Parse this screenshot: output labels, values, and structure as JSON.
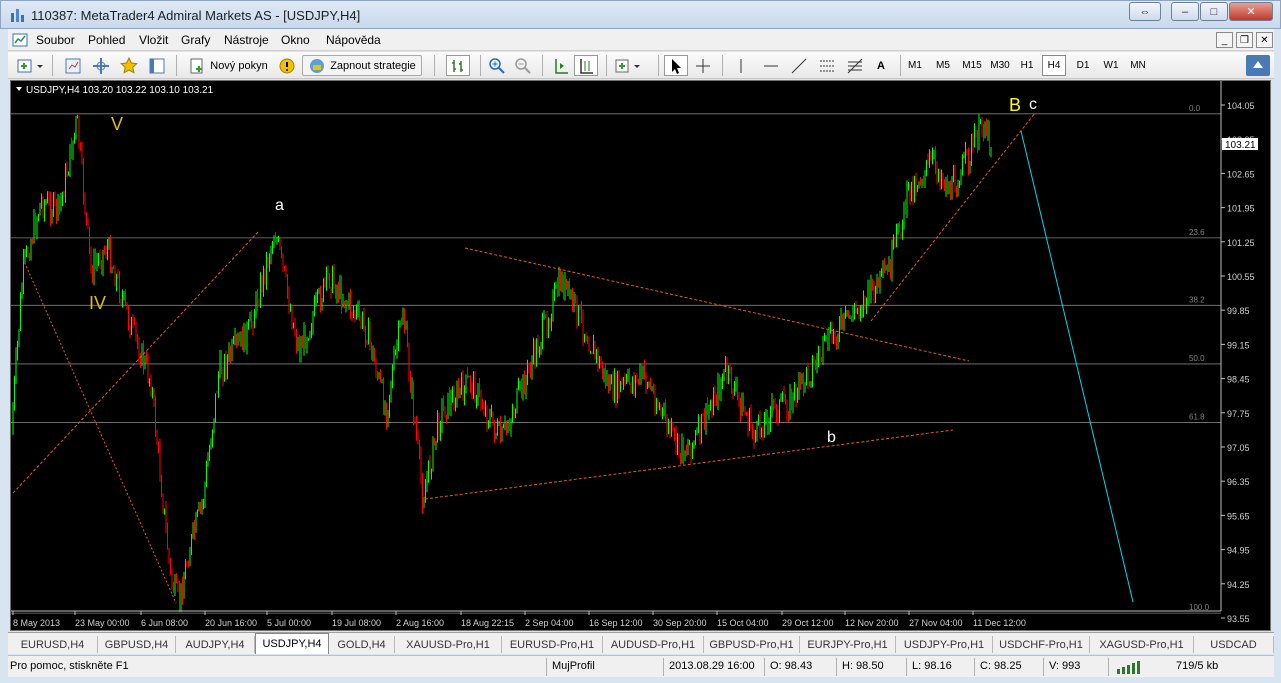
{
  "window": {
    "title": "110387: MetaTrader4 Admiral Markets AS - [USDJPY,H4]",
    "controls": {
      "restore": "⇔",
      "minimize": "–",
      "maximize": "□",
      "close": "✕"
    }
  },
  "menu": {
    "items": [
      "Soubor",
      "Pohled",
      "Vložit",
      "Grafy",
      "Nástroje",
      "Okno",
      "Nápověda"
    ],
    "mdi_controls": [
      "_",
      "❐",
      "✕"
    ]
  },
  "toolbar": {
    "new_order_label": "Nový pokyn",
    "expert_label": "Zapnout strategie",
    "drawing_tools": [
      "A"
    ],
    "timeframes": [
      "M1",
      "M5",
      "M15",
      "M30",
      "H1",
      "H4",
      "D1",
      "W1",
      "MN"
    ],
    "active_timeframe": "H4"
  },
  "chart": {
    "header": "USDJPY,H4  103.20 103.22 103.10 103.21",
    "current_price": "103.21",
    "background": "#000000",
    "bull_color": "#00ff00",
    "bear_color": "#ff0000",
    "price_axis": [
      "104.05",
      "103.35",
      "102.65",
      "101.95",
      "101.25",
      "100.55",
      "99.85",
      "99.15",
      "98.45",
      "97.75",
      "97.05",
      "96.35",
      "95.65",
      "94.95",
      "94.25",
      "93.55"
    ],
    "time_axis": [
      "8 May 2013",
      "23 May 00:00",
      "6 Jun 08:00",
      "20 Jun 16:00",
      "5 Jul 00:00",
      "19 Jul 08:00",
      "2 Aug 16:00",
      "18 Aug 22:15",
      "2 Sep 04:00",
      "16 Sep 12:00",
      "30 Sep 20:00",
      "15 Oct 04:00",
      "29 Oct 12:00",
      "12 Nov 20:00",
      "27 Nov 04:00",
      "11 Dec 12:00"
    ],
    "fib_levels": [
      {
        "label": "0.0",
        "price": 103.87
      },
      {
        "label": "23.6",
        "price": 101.33
      },
      {
        "label": "38.2",
        "price": 99.95
      },
      {
        "label": "50.0",
        "price": 98.75
      },
      {
        "label": "61.8",
        "price": 97.55
      },
      {
        "label": "100.0",
        "price": 93.65
      }
    ],
    "wave_labels": [
      {
        "text": "V",
        "color": "#e0c000"
      },
      {
        "text": "IV",
        "color": "#e0c000"
      },
      {
        "text": "a",
        "color": "#ffffff"
      },
      {
        "text": "b",
        "color": "#ffffff"
      },
      {
        "text": "B",
        "color": "#ffff00"
      },
      {
        "text": "c",
        "color": "#ffffff"
      }
    ],
    "line_colors": {
      "trend": "#e05a2a",
      "projection": "#00d8e8",
      "fib": "#808080"
    }
  },
  "tabs": {
    "items": [
      "EURUSD,H4",
      "GBPUSD,H4",
      "AUDJPY,H4",
      "USDJPY,H4",
      "GOLD,H4",
      "XAUUSD-Pro,H1",
      "EURUSD-Pro,H1",
      "AUDUSD-Pro,H1",
      "GBPUSD-Pro,H1",
      "EURJPY-Pro,H1",
      "USDJPY-Pro,H1",
      "USDCHF-Pro,H1",
      "XAGUSD-Pro,H1",
      "USDCAD"
    ],
    "active": "USDJPY,H4"
  },
  "status": {
    "help": "Pro pomoc, stiskněte F1",
    "profile": "MujProfil",
    "datetime": "2013.08.29 16:00",
    "open": "O: 98.43",
    "high": "H: 98.50",
    "low": "L: 98.16",
    "close": "C: 98.25",
    "volume": "V: 993",
    "traffic": "719/5 kb"
  }
}
